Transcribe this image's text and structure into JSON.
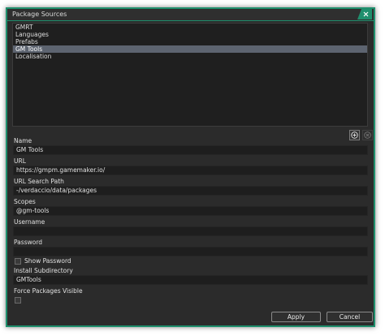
{
  "window": {
    "title": "Package Sources",
    "accent_color": "#1f8f6d"
  },
  "sources": {
    "items": [
      "GMRT",
      "Languages",
      "Prefabs",
      "GM Tools",
      "Localisation"
    ],
    "selected": "GM Tools"
  },
  "list_controls": {
    "add_icon": "plus-circle-icon",
    "remove_icon": "x-circle-icon"
  },
  "form": {
    "name_label": "Name",
    "name_value": "GM Tools",
    "url_label": "URL",
    "url_value": "https://gmpm.gamemaker.io/",
    "search_path_label": "URL Search Path",
    "search_path_value": "-/verdaccio/data/packages",
    "scopes_label": "Scopes",
    "scopes_value": "@gm-tools",
    "username_label": "Username",
    "username_value": "",
    "password_label": "Password",
    "password_value": "",
    "show_password_label": "Show Password",
    "show_password_checked": false,
    "install_subdir_label": "Install Subdirectory",
    "install_subdir_value": "GMTools",
    "force_visible_label": "Force Packages Visible",
    "force_visible_checked": false
  },
  "footer": {
    "apply_label": "Apply",
    "cancel_label": "Cancel"
  }
}
